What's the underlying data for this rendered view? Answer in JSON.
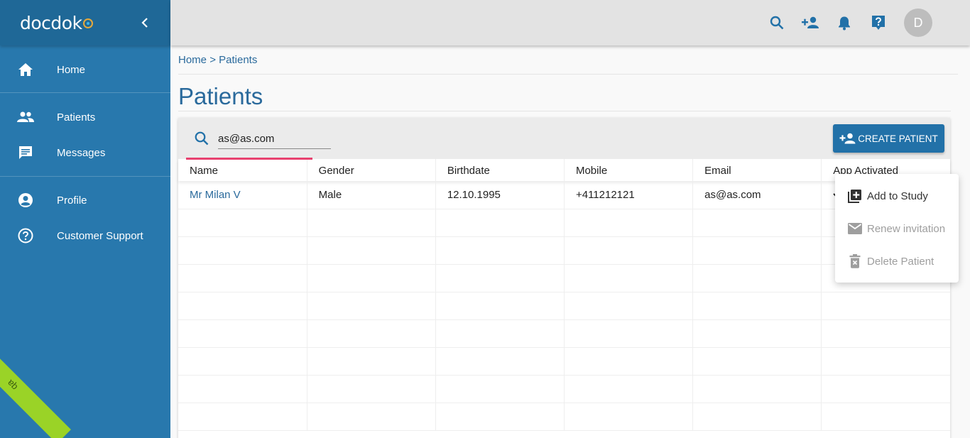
{
  "sidebar": {
    "logo": "docdok",
    "items": [
      {
        "label": "Home",
        "icon": "home-icon"
      },
      {
        "label": "Patients",
        "icon": "people-icon"
      },
      {
        "label": "Messages",
        "icon": "message-icon"
      },
      {
        "label": "Profile",
        "icon": "account-circle-icon"
      },
      {
        "label": "Customer Support",
        "icon": "help-circle-icon"
      }
    ],
    "ribbon": "qa"
  },
  "topbar": {
    "icons": [
      "search-icon",
      "person-add-icon",
      "bell-icon",
      "help-box-icon"
    ],
    "avatar_initial": "D"
  },
  "breadcrumb": {
    "home": "Home",
    "separator": ">",
    "current": "Patients"
  },
  "page": {
    "title": "Patients"
  },
  "search": {
    "value": "as@as.com"
  },
  "create_button": {
    "label": "CREATE PATIENT"
  },
  "table": {
    "columns": [
      "Name",
      "Gender",
      "Birthdate",
      "Mobile",
      "Email",
      "App Activated"
    ],
    "rows": [
      {
        "name": "Mr Milan V",
        "gender": "Male",
        "birthdate": "12.10.1995",
        "mobile": "+411212121",
        "email": "as@as.com"
      }
    ]
  },
  "menu": {
    "items": [
      {
        "label": "Add to Study",
        "icon": "library-add-icon",
        "enabled": true
      },
      {
        "label": "Renew invitation",
        "icon": "mail-icon",
        "enabled": false
      },
      {
        "label": "Delete Patient",
        "icon": "delete-icon",
        "enabled": false
      }
    ]
  },
  "colors": {
    "sidebar": "#2878ad",
    "primary": "#2271a8",
    "accent": "#e8416f",
    "topbar": "#e3e3e3"
  }
}
